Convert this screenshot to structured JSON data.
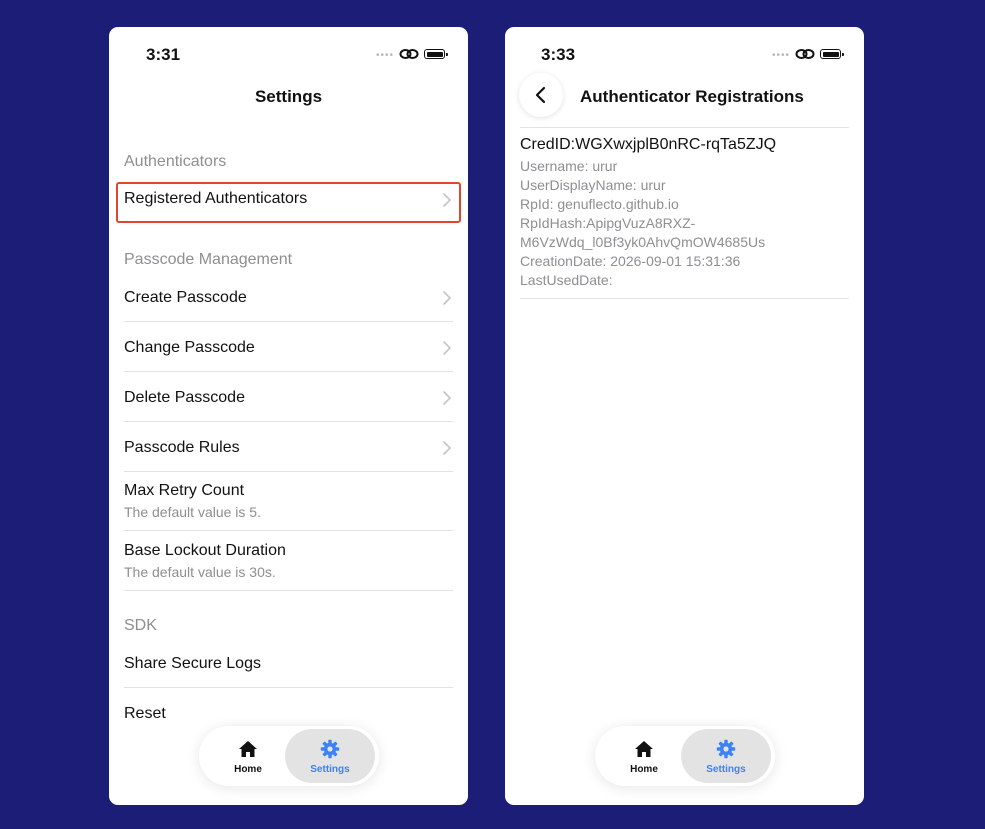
{
  "left": {
    "status_time": "3:31",
    "nav_title": "Settings",
    "sections": {
      "authenticators": "Authenticators",
      "passcode_management": "Passcode Management",
      "sdk": "SDK"
    },
    "rows": {
      "registered_authenticators": "Registered Authenticators",
      "create_passcode": "Create Passcode",
      "change_passcode": "Change Passcode",
      "delete_passcode": "Delete Passcode",
      "passcode_rules": "Passcode Rules",
      "max_retry_count": "Max Retry Count",
      "max_retry_count_sub": "The default value is 5.",
      "base_lockout_duration": "Base Lockout Duration",
      "base_lockout_duration_sub": "The default value is 30s.",
      "share_secure_logs": "Share Secure Logs",
      "reset": "Reset"
    },
    "tabbar": {
      "home_label": "Home",
      "settings_label": "Settings",
      "active": "Settings"
    }
  },
  "right": {
    "status_time": "3:33",
    "nav_title": "Authenticator Registrations",
    "credential": {
      "cred_id": "CredID:WGXwxjplB0nRC-rqTa5ZJQ",
      "username": "Username: urur",
      "user_display_name": "UserDisplayName: urur",
      "rp_id": "RpId: genuflecto.github.io",
      "rp_id_hash_1": "RpIdHash:ApipgVuzA8RXZ-",
      "rp_id_hash_2": "M6VzWdq_l0Bf3yk0AhvQmOW4685Us",
      "creation_date": "CreationDate: 2026-09-01 15:31:36",
      "last_used_date": "LastUsedDate:"
    },
    "tabbar": {
      "home_label": "Home",
      "settings_label": "Settings",
      "active": "Settings"
    }
  },
  "colors": {
    "background": "#1b1d77",
    "highlight": "#e2452f",
    "accent": "#3b82f6",
    "secondary_text": "#8e8e93"
  },
  "icons": {
    "status": [
      "signal-dots-icon",
      "link-icon",
      "battery-icon"
    ],
    "chevron": "chevron-right-icon",
    "back": "chevron-left-icon",
    "tabs": [
      "home-icon",
      "gear-icon"
    ]
  }
}
